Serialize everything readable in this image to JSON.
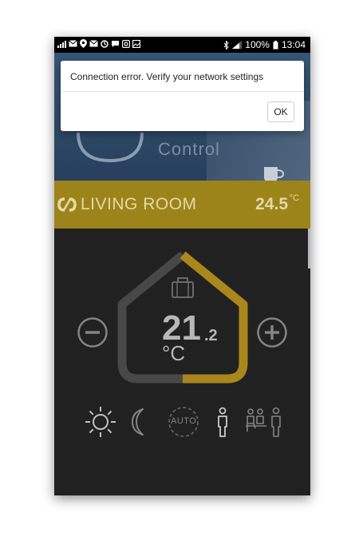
{
  "status_bar": {
    "battery": "100%",
    "time": "13:04"
  },
  "hero": {
    "brand_text": "Control"
  },
  "room": {
    "name": "LIVING ROOM",
    "current_temp": "24.5",
    "unit": "°C"
  },
  "thermostat": {
    "setpoint_integer": "21",
    "setpoint_decimal": ".2",
    "unit": "°C",
    "setpoint_value": 21.2
  },
  "modes": {
    "auto_label": "AUTO"
  },
  "dialog": {
    "message": "Connection error. Verify your network settings",
    "ok_label": "OK"
  },
  "colors": {
    "accent_gold": "#a38a1c",
    "house_gold": "#b08d1e",
    "house_gray": "#4b4b4b",
    "background": "#232323"
  }
}
